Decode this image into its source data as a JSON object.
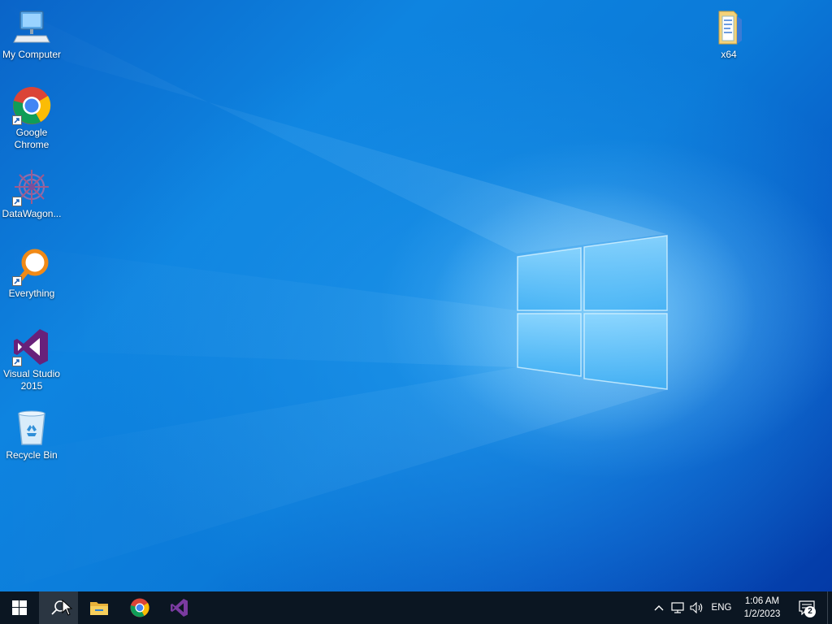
{
  "desktop": {
    "icons": [
      {
        "id": "my-computer",
        "label": "My Computer"
      },
      {
        "id": "google-chrome",
        "label": "Google\nChrome"
      },
      {
        "id": "datawagon",
        "label": "DataWagon..."
      },
      {
        "id": "everything",
        "label": "Everything"
      },
      {
        "id": "visual-studio",
        "label": "Visual Studio\n2015"
      },
      {
        "id": "recycle-bin",
        "label": "Recycle Bin"
      },
      {
        "id": "x64",
        "label": "x64"
      }
    ]
  },
  "taskbar": {
    "pinned": [
      {
        "name": "start-button",
        "icon": "windows-logo-icon"
      },
      {
        "name": "search-button",
        "icon": "search-icon"
      },
      {
        "name": "file-explorer-button",
        "icon": "folder-icon"
      },
      {
        "name": "chrome-taskbar-button",
        "icon": "chrome-icon"
      },
      {
        "name": "visual-studio-taskbar-button",
        "icon": "visual-studio-icon"
      }
    ],
    "tray": {
      "language": "ENG",
      "time": "1:06 AM",
      "date": "1/2/2023",
      "notification_count": "2"
    }
  },
  "colors": {
    "taskbar_bg": "#0b1622",
    "desktop_accent": "#0e84e0"
  }
}
